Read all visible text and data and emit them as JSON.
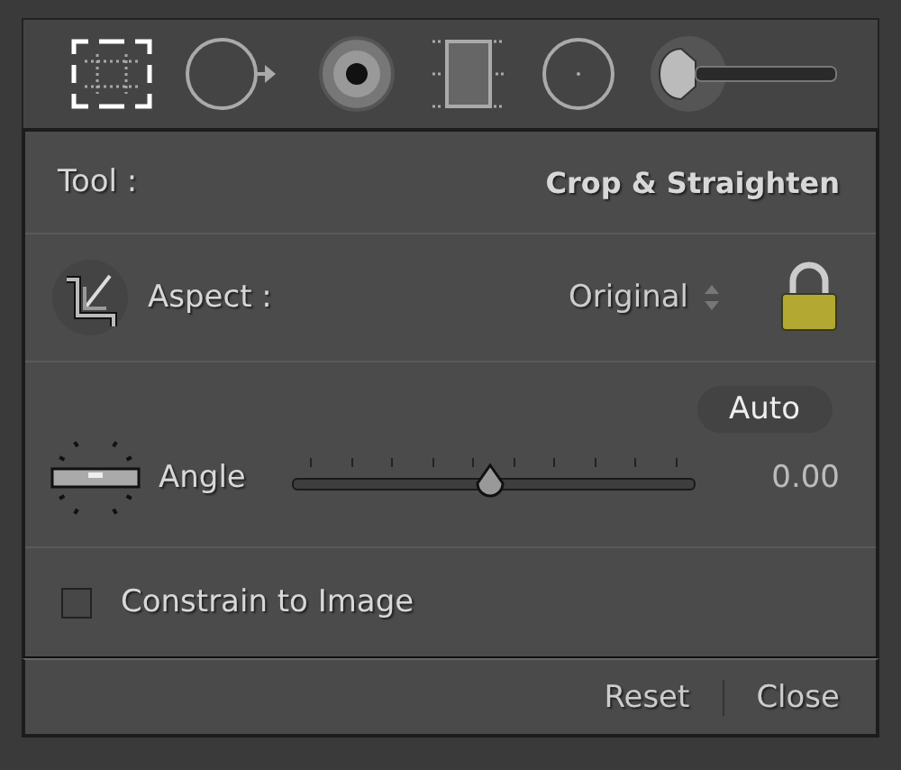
{
  "tools": [
    {
      "kind": "crop",
      "selected": true
    },
    {
      "kind": "spot",
      "selected": false
    },
    {
      "kind": "redeye",
      "selected": false
    },
    {
      "kind": "graduated",
      "selected": false
    },
    {
      "kind": "radial",
      "selected": false
    },
    {
      "kind": "brush",
      "selected": false
    }
  ],
  "tool_row": {
    "label": "Tool :",
    "value": "Crop & Straighten"
  },
  "aspect": {
    "label": "Aspect :",
    "value": "Original",
    "locked": true
  },
  "angle": {
    "auto_button": "Auto",
    "label": "Angle",
    "level": 0.49,
    "reading": "0.00"
  },
  "constrain": {
    "label": "Constrain to Image",
    "checked": false
  },
  "footer": {
    "buttons": [
      "Reset",
      "Close"
    ]
  }
}
